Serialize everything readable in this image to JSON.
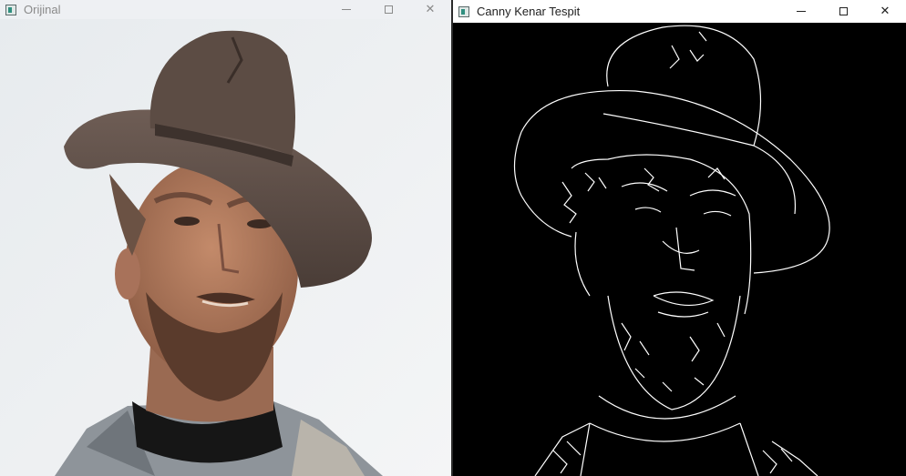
{
  "windows": {
    "left": {
      "title": "Orijinal",
      "controls": {
        "minimize": "—",
        "maximize": "",
        "close": "✕"
      }
    },
    "right": {
      "title": "Canny Kenar Tespit",
      "controls": {
        "minimize": "—",
        "maximize": "",
        "close": "✕"
      }
    }
  },
  "colors": {
    "photo_background": "#eef0f2",
    "hat": "#5a4a42",
    "skin": "#b07a5e",
    "beard": "#5a3b2c",
    "scarf": "#161616",
    "edges_background": "#000000",
    "edges_stroke": "#ffffff"
  },
  "icons": [
    "app-icon",
    "minimize-icon",
    "maximize-icon",
    "close-icon"
  ]
}
